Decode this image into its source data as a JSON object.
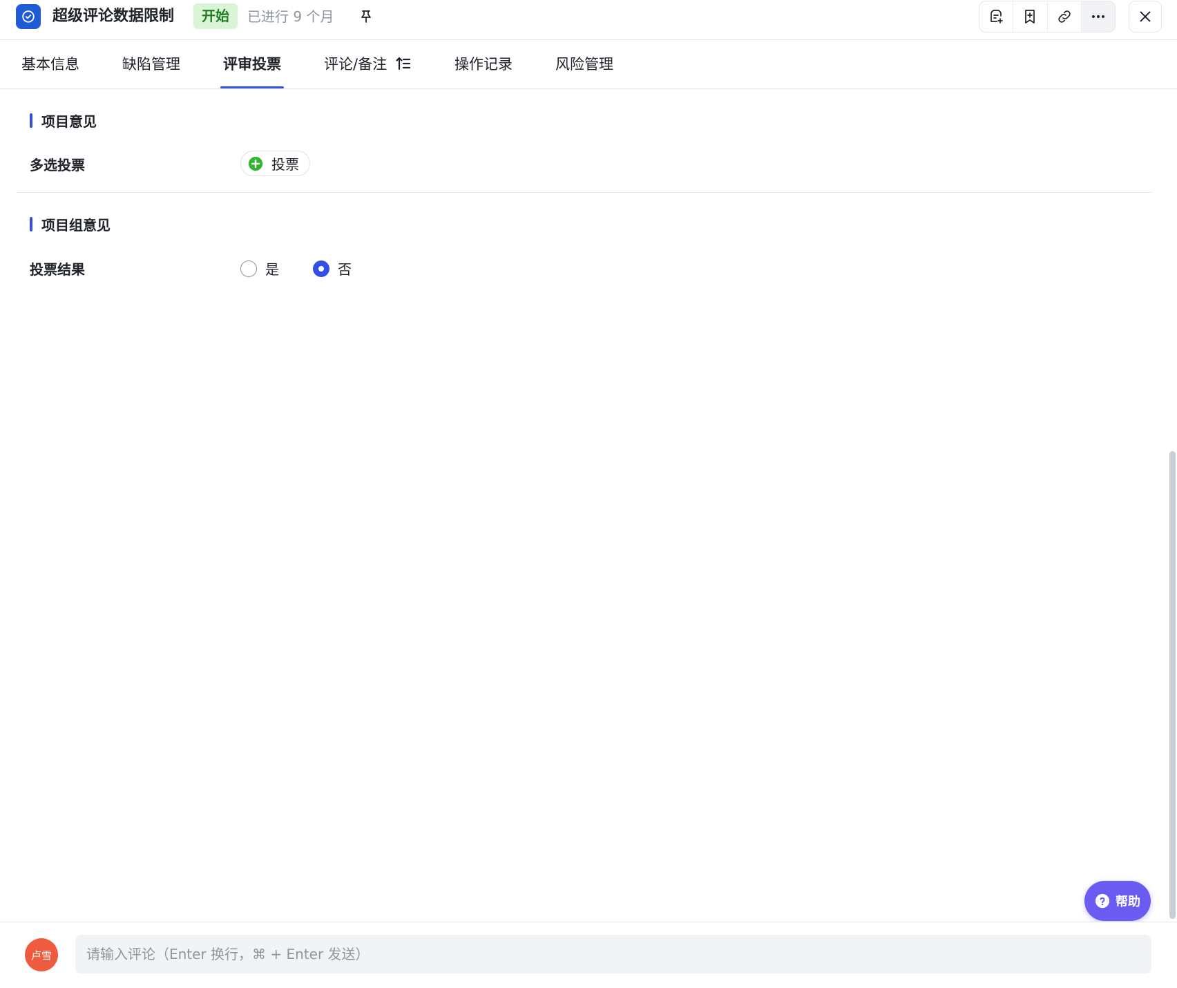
{
  "header": {
    "title": "超级评论数据限制",
    "status": "开始",
    "elapsed": "已进行 9 个月",
    "icons": [
      "check-circle-icon",
      "pin-icon",
      "comment-add-icon",
      "bookmark-add-icon",
      "link-icon",
      "more-icon",
      "close-icon"
    ]
  },
  "tabs": [
    {
      "label": "基本信息"
    },
    {
      "label": "缺陷管理"
    },
    {
      "label": "评审投票",
      "active": true
    },
    {
      "label": "评论/备注"
    },
    {
      "label": "操作记录"
    },
    {
      "label": "风险管理"
    }
  ],
  "sections": {
    "project_opinion": {
      "title": "项目意见",
      "field_label": "多选投票",
      "vote_button": "投票"
    },
    "group_opinion": {
      "title": "项目组意见",
      "field_label": "投票结果",
      "options": [
        {
          "label": "是",
          "checked": false
        },
        {
          "label": "否",
          "checked": true
        }
      ]
    }
  },
  "help": {
    "label": "帮助"
  },
  "footer": {
    "avatar_text": "卢雪",
    "comment_placeholder": "请输入评论（Enter 换行，⌘ + Enter 发送）"
  },
  "colors": {
    "accent": "#3250e6",
    "status_bg": "#d9f5d6",
    "status_text": "#237a23",
    "help_bg": "#6a5cf0",
    "avatar_bg": "#ee5b3f",
    "plus_icon": "#2fb52f"
  }
}
